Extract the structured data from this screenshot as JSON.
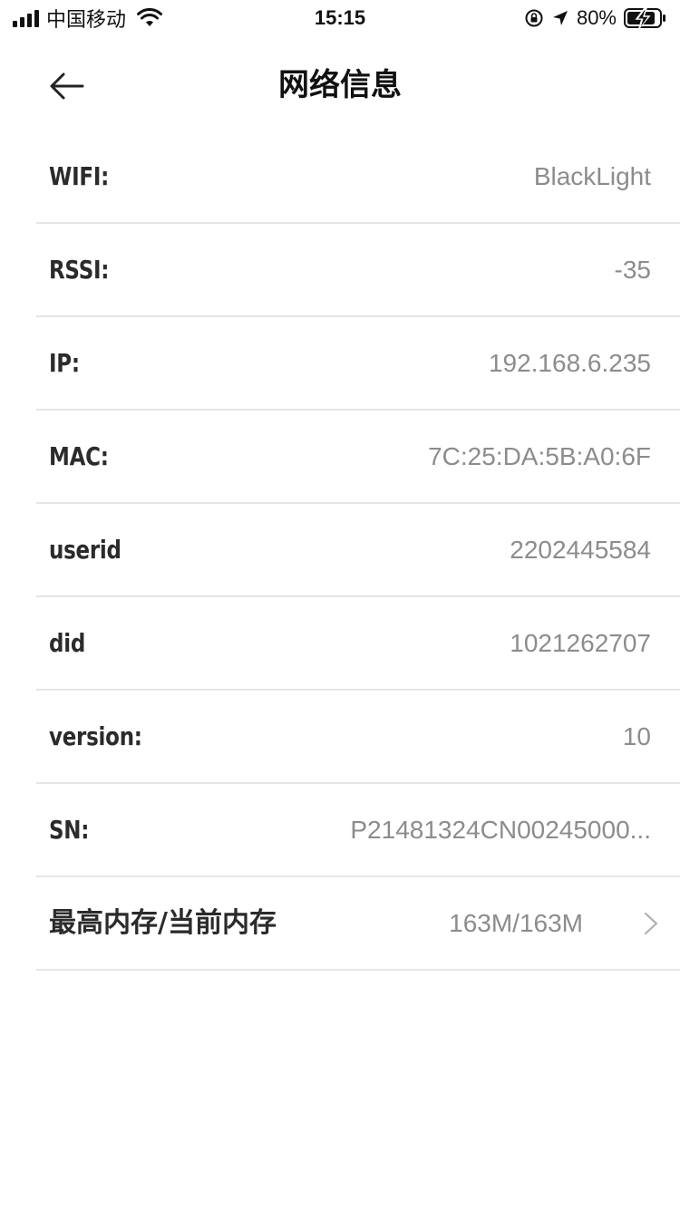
{
  "status_bar": {
    "carrier": "中国移动",
    "time": "15:15",
    "battery_percent": "80%",
    "icons": [
      "signal-icon",
      "wifi-icon",
      "orientation-lock-icon",
      "location-arrow-icon",
      "battery-charging-icon"
    ]
  },
  "nav": {
    "title": "网络信息",
    "back_icon": "back-arrow-icon"
  },
  "rows": [
    {
      "label": "WIFI:",
      "value": "BlackLight"
    },
    {
      "label": "RSSI:",
      "value": "-35"
    },
    {
      "label": "IP:",
      "value": "192.168.6.235"
    },
    {
      "label": "MAC:",
      "value": "7C:25:DA:5B:A0:6F"
    },
    {
      "label": "userid",
      "value": "2202445584"
    },
    {
      "label": "did",
      "value": "1021262707"
    },
    {
      "label": "version:",
      "value": "10"
    },
    {
      "label": "SN:",
      "value": "P21481324CN00245000..."
    }
  ],
  "memory": {
    "label": "最高内存/当前内存",
    "value": "163M/163M",
    "icon": "chevron-right-icon"
  },
  "colors": {
    "label": "#2b2b2b",
    "value": "#8c8c8c",
    "divider": "#e5e5e5",
    "background": "#ffffff"
  }
}
